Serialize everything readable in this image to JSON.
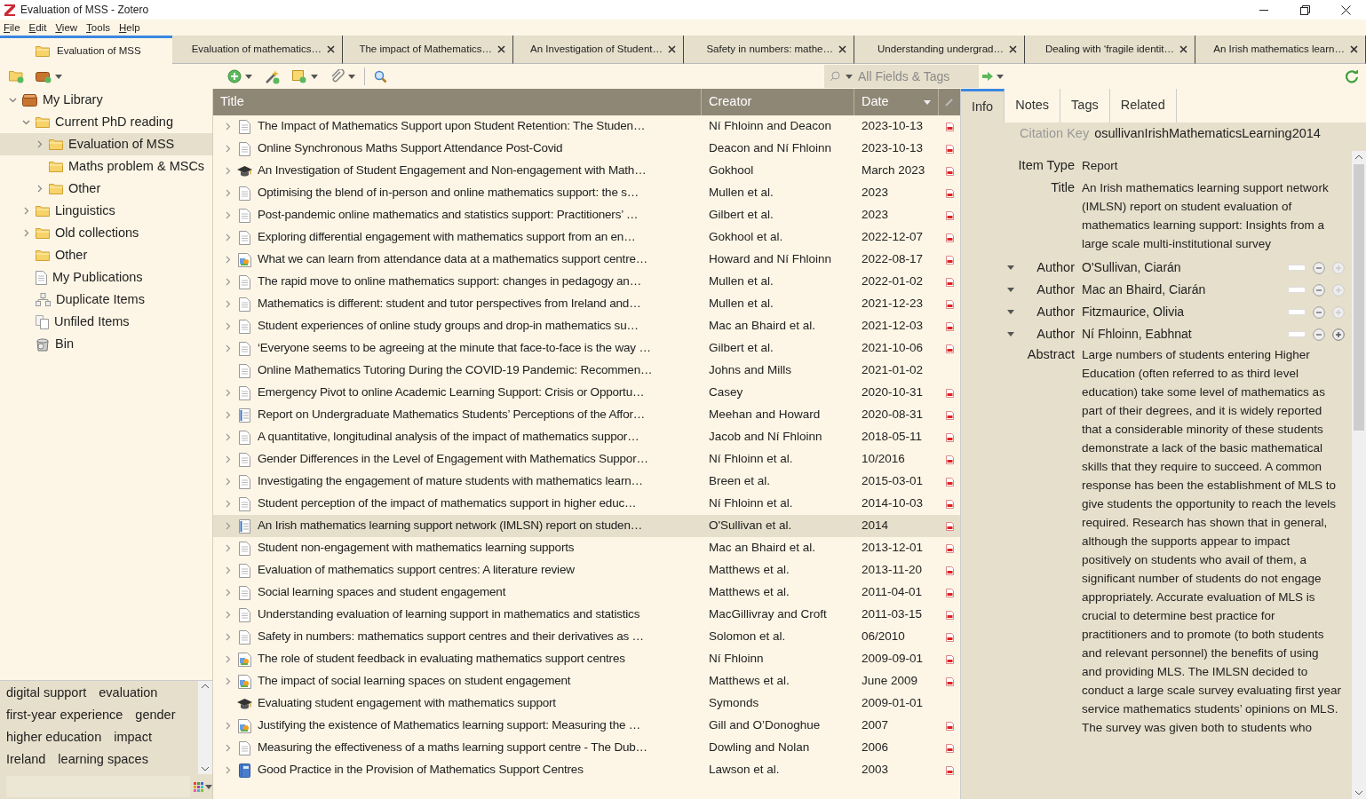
{
  "window": {
    "title": "Evaluation of MSS - Zotero"
  },
  "menu": [
    "File",
    "Edit",
    "View",
    "Tools",
    "Help"
  ],
  "tabs": [
    {
      "label": "Evaluation of MSS",
      "selected": true,
      "kind": "library"
    },
    {
      "label": "Evaluation of mathematics…",
      "selected": false,
      "kind": "reader"
    },
    {
      "label": "The impact of Mathematics…",
      "selected": false,
      "kind": "reader"
    },
    {
      "label": "An Investigation of Student…",
      "selected": false,
      "kind": "reader"
    },
    {
      "label": "Safety in numbers: mathe…",
      "selected": false,
      "kind": "reader"
    },
    {
      "label": "Understanding undergrad…",
      "selected": false,
      "kind": "reader"
    },
    {
      "label": "Dealing with ‘fragile identit…",
      "selected": false,
      "kind": "reader"
    },
    {
      "label": "An Irish mathematics learn…",
      "selected": false,
      "kind": "reader"
    }
  ],
  "search": {
    "placeholder": "All Fields & Tags"
  },
  "collections": [
    {
      "label": "My Library",
      "kind": "library",
      "expanded": true,
      "selected": false,
      "children": [
        {
          "label": "Current PhD reading",
          "kind": "folder",
          "expanded": true,
          "selected": false,
          "children": [
            {
              "label": "Evaluation of MSS",
              "kind": "folder",
              "expanded": false,
              "selected": true
            },
            {
              "label": "Maths problem & MSCs",
              "kind": "folder",
              "selected": false
            },
            {
              "label": "Other",
              "kind": "folder",
              "expanded": false,
              "selected": false
            }
          ]
        },
        {
          "label": "Linguistics",
          "kind": "folder",
          "expanded": false,
          "selected": false
        },
        {
          "label": "Old collections",
          "kind": "folder",
          "expanded": false,
          "selected": false
        },
        {
          "label": "Other",
          "kind": "folder",
          "selected": false
        },
        {
          "label": "My Publications",
          "kind": "publications",
          "selected": false
        },
        {
          "label": "Duplicate Items",
          "kind": "duplicates",
          "selected": false
        },
        {
          "label": "Unfiled Items",
          "kind": "unfiled",
          "selected": false
        },
        {
          "label": "Bin",
          "kind": "bin",
          "selected": false
        }
      ]
    }
  ],
  "tags": [
    "digital support",
    "evaluation",
    "first-year experience",
    "gender",
    "higher education",
    "impact",
    "Ireland",
    "learning spaces"
  ],
  "table": {
    "columns": [
      {
        "label": "Title",
        "sorted": false
      },
      {
        "label": "Creator",
        "sorted": false
      },
      {
        "label": "Date",
        "sorted": true
      }
    ],
    "rows": [
      {
        "title": "The Impact of Mathematics Support upon Student Retention: The Studen…",
        "creator": "Ní Fhloinn and Deacon",
        "date": "2023-10-13",
        "kind": "document",
        "expandable": true,
        "pdf": true,
        "selected": false
      },
      {
        "title": "Online Synchronous Maths Support Attendance Post-Covid",
        "creator": "Deacon and Ní Fhloinn",
        "date": "2023-10-13",
        "kind": "document",
        "expandable": true,
        "pdf": true,
        "selected": false
      },
      {
        "title": "An Investigation of Student Engagement and Non-engagement with Math…",
        "creator": "Gokhool",
        "date": "March 2023",
        "kind": "thesis",
        "expandable": true,
        "pdf": true,
        "selected": false
      },
      {
        "title": "Optimising the blend of in-person and online mathematics support: the s…",
        "creator": "Mullen et al.",
        "date": "2023",
        "kind": "document",
        "expandable": true,
        "pdf": true,
        "selected": false
      },
      {
        "title": "Post-pandemic online mathematics and statistics support: Practitioners’ …",
        "creator": "Gilbert et al.",
        "date": "2023",
        "kind": "document",
        "expandable": true,
        "pdf": true,
        "selected": false
      },
      {
        "title": "Exploring differential engagement with mathematics support from an en…",
        "creator": "Gokhool et al.",
        "date": "2022-12-07",
        "kind": "document",
        "expandable": true,
        "pdf": true,
        "selected": false
      },
      {
        "title": "What we can learn from attendance data at a mathematics support centre…",
        "creator": "Howard and Ní Fhloinn",
        "date": "2022-08-17",
        "kind": "presentation",
        "expandable": true,
        "pdf": true,
        "selected": false
      },
      {
        "title": "The rapid move to online mathematics support: changes in pedagogy an…",
        "creator": "Mullen et al.",
        "date": "2022-01-02",
        "kind": "document",
        "expandable": true,
        "pdf": true,
        "selected": false
      },
      {
        "title": "Mathematics is different: student and tutor perspectives from Ireland and…",
        "creator": "Mullen et al.",
        "date": "2021-12-23",
        "kind": "document",
        "expandable": true,
        "pdf": true,
        "selected": false
      },
      {
        "title": "Student experiences of online study groups and drop-in mathematics su…",
        "creator": "Mac an Bhaird et al.",
        "date": "2021-12-03",
        "kind": "document",
        "expandable": true,
        "pdf": true,
        "selected": false
      },
      {
        "title": "‘Everyone seems to be agreeing at the minute that face-to-face is the way …",
        "creator": "Gilbert et al.",
        "date": "2021-10-06",
        "kind": "document",
        "expandable": true,
        "pdf": true,
        "selected": false
      },
      {
        "title": "Online Mathematics Tutoring During the COVID-19 Pandemic: Recommen…",
        "creator": "Johns and Mills",
        "date": "2021-01-02",
        "kind": "document",
        "expandable": false,
        "pdf": false,
        "selected": false
      },
      {
        "title": "Emergency Pivot to online Academic Learning Support: Crisis or Opportu…",
        "creator": "Casey",
        "date": "2020-10-31",
        "kind": "document",
        "expandable": true,
        "pdf": true,
        "selected": false
      },
      {
        "title": "Report on Undergraduate Mathematics Students’ Perceptions of the Affor…",
        "creator": "Meehan and Howard",
        "date": "2020-08-31",
        "kind": "report",
        "expandable": true,
        "pdf": true,
        "selected": false
      },
      {
        "title": "A quantitative, longitudinal analysis of the impact of mathematics suppor…",
        "creator": "Jacob and Ní Fhloinn",
        "date": "2018-05-11",
        "kind": "document",
        "expandable": true,
        "pdf": true,
        "selected": false
      },
      {
        "title": "Gender Differences in the Level of Engagement with Mathematics Suppor…",
        "creator": "Ní Fhloinn et al.",
        "date": "10/2016",
        "kind": "document",
        "expandable": true,
        "pdf": true,
        "selected": false
      },
      {
        "title": "Investigating the engagement of mature students with mathematics learn…",
        "creator": "Breen et al.",
        "date": "2015-03-01",
        "kind": "document",
        "expandable": true,
        "pdf": true,
        "selected": false
      },
      {
        "title": "Student perception of the impact of mathematics support in higher educ…",
        "creator": "Ní Fhloinn et al.",
        "date": "2014-10-03",
        "kind": "document",
        "expandable": true,
        "pdf": true,
        "selected": false
      },
      {
        "title": "An Irish mathematics learning support network (IMLSN) report on studen…",
        "creator": "O'Sullivan et al.",
        "date": "2014",
        "kind": "report",
        "expandable": true,
        "pdf": true,
        "selected": true
      },
      {
        "title": "Student non-engagement with mathematics learning supports",
        "creator": "Mac an Bhaird et al.",
        "date": "2013-12-01",
        "kind": "document",
        "expandable": true,
        "pdf": true,
        "selected": false
      },
      {
        "title": "Evaluation of mathematics support centres: A literature review",
        "creator": "Matthews et al.",
        "date": "2013-11-20",
        "kind": "document",
        "expandable": true,
        "pdf": true,
        "selected": false
      },
      {
        "title": "Social learning spaces and student engagement",
        "creator": "Matthews et al.",
        "date": "2011-04-01",
        "kind": "document",
        "expandable": true,
        "pdf": true,
        "selected": false
      },
      {
        "title": "Understanding evaluation of learning support in mathematics and statistics",
        "creator": "MacGillivray and Croft",
        "date": "2011-03-15",
        "kind": "document",
        "expandable": true,
        "pdf": true,
        "selected": false
      },
      {
        "title": "Safety in numbers: mathematics support centres and their derivatives as …",
        "creator": "Solomon et al.",
        "date": "06/2010",
        "kind": "document",
        "expandable": true,
        "pdf": true,
        "selected": false
      },
      {
        "title": "The role of student feedback in evaluating mathematics support centres",
        "creator": "Ní Fhloinn",
        "date": "2009-09-01",
        "kind": "presentation",
        "expandable": true,
        "pdf": true,
        "selected": false
      },
      {
        "title": "The impact of social learning spaces on student engagement",
        "creator": "Matthews et al.",
        "date": "June 2009",
        "kind": "presentation",
        "expandable": true,
        "pdf": true,
        "selected": false
      },
      {
        "title": "Evaluating student engagement with mathematics support",
        "creator": "Symonds",
        "date": "2009-01-01",
        "kind": "thesis",
        "expandable": false,
        "pdf": false,
        "selected": false
      },
      {
        "title": "Justifying the existence of Mathematics learning support: Measuring the …",
        "creator": "Gill and O’Donoghue",
        "date": "2007",
        "kind": "presentation",
        "expandable": true,
        "pdf": true,
        "selected": false
      },
      {
        "title": "Measuring the effectiveness of a maths learning support centre - The Dub…",
        "creator": "Dowling and Nolan",
        "date": "2006",
        "kind": "document",
        "expandable": true,
        "pdf": true,
        "selected": false
      },
      {
        "title": "Good Practice in the Provision of Mathematics Support Centres",
        "creator": "Lawson et al.",
        "date": "2003",
        "kind": "book",
        "expandable": true,
        "pdf": true,
        "selected": false
      }
    ]
  },
  "item_pane": {
    "tabs": [
      {
        "label": "Info",
        "selected": true
      },
      {
        "label": "Notes",
        "selected": false
      },
      {
        "label": "Tags",
        "selected": false
      },
      {
        "label": "Related",
        "selected": false
      }
    ],
    "citation_key": {
      "label": "Citation Key",
      "value": "osullivanIrishMathematicsLearning2014"
    },
    "fields": [
      {
        "kind": "field",
        "label": "Item Type",
        "value": "Report"
      },
      {
        "kind": "field",
        "label": "Title",
        "value": "An Irish mathematics learning support network (IMLSN) report on student evaluation of mathematics learning support: Insights from a large scale multi-institutional survey"
      },
      {
        "kind": "creator",
        "label": "Author",
        "value": "O'Sullivan, Ciarán",
        "can_add": false
      },
      {
        "kind": "creator",
        "label": "Author",
        "value": "Mac an Bhaird, Ciarán",
        "can_add": false
      },
      {
        "kind": "creator",
        "label": "Author",
        "value": "Fitzmaurice, Olivia",
        "can_add": false
      },
      {
        "kind": "creator",
        "label": "Author",
        "value": "Ní Fhloinn, Eabhnat",
        "can_add": true
      },
      {
        "kind": "field",
        "label": "Abstract",
        "value": "Large numbers of students entering Higher Education (often referred to as third level education) take some level of mathematics as part of their degrees, and it is widely reported that a considerable minority of these students demonstrate a lack of the basic mathematical skills that they require to succeed. A common response has been the establishment of MLS to give students the opportunity to reach the levels required. Research has shown that in general, although the supports appear to impact positively on students who avail of them, a significant number of students do not engage appropriately. Accurate evaluation of MLS is crucial to determine best practice for practitioners and to promote (to both students and relevant personnel) the benefits of using and providing MLS. The IMLSN decided to conduct a large scale survey evaluating first year service mathematics students’ opinions on MLS. The survey was given both to students who"
      }
    ]
  }
}
